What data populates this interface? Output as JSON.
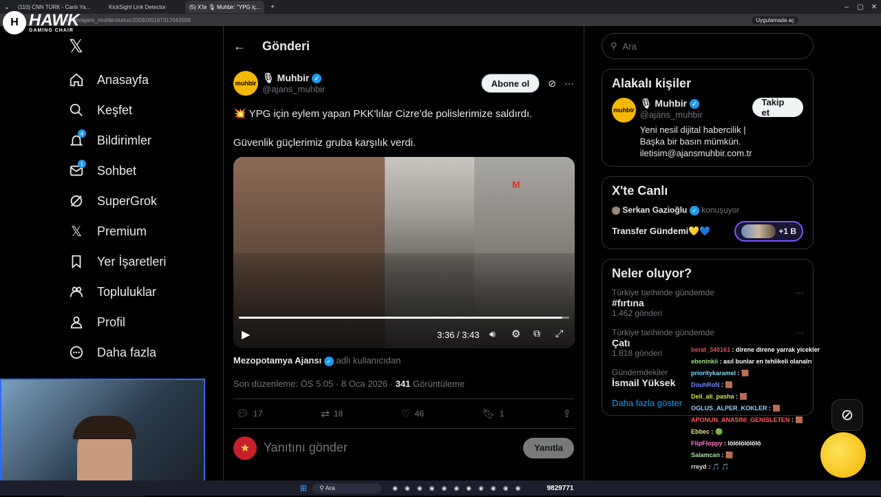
{
  "browser": {
    "tabs": [
      "(110) CNN TÜRK - Canlı Ya...",
      "KickSight Link Detector",
      "(5) X'te 🎙 Muhbir: \"YPG iç..."
    ],
    "url": "x.com/ajans_muhbir/status/2009265167317043508",
    "app_button": "Uygulamada aç"
  },
  "overlay": {
    "brand": "HAWK",
    "brand_sub": "GAMING CHAIR"
  },
  "nav": {
    "items": [
      {
        "label": "Anasayfa",
        "icon": "home-icon"
      },
      {
        "label": "Keşfet",
        "icon": "search-icon"
      },
      {
        "label": "Bildirimler",
        "icon": "bell-icon",
        "badge": "4"
      },
      {
        "label": "Sohbet",
        "icon": "mail-icon",
        "badge": "1"
      },
      {
        "label": "SuperGrok",
        "icon": "grok-icon"
      },
      {
        "label": "Premium",
        "icon": "x-icon"
      },
      {
        "label": "Yer İşaretleri",
        "icon": "bookmark-icon"
      },
      {
        "label": "Topluluklar",
        "icon": "people-icon"
      },
      {
        "label": "Profil",
        "icon": "person-icon"
      },
      {
        "label": "Daha fazla",
        "icon": "more-icon"
      }
    ]
  },
  "post": {
    "header": "Gönderi",
    "author_name": "🎙 Muhbir",
    "author_handle": "@ajans_muhbir",
    "subscribe": "Abone ol",
    "text1": "💥 YPG için eylem yapan PKK'lılar Cizre'de polislerimize saldırdı.",
    "text2": "Güvenlik güçlerimiz gruba karşılık verdi.",
    "video_time": "3:36 / 3:43",
    "video_progress": 0.98,
    "source_name": "Mezopotamya Ajansı",
    "source_suffix": "adlı kullanıcıdan",
    "edited": "Son düzenleme: ÖS 5:05 · 8 Oca 2026 ·",
    "views": "341",
    "views_label": "Görüntüleme",
    "replies": "17",
    "reposts": "18",
    "likes": "46",
    "bookmarks": "1",
    "reply_placeholder": "Yanıtını gönder",
    "reply_button": "Yanıtla"
  },
  "sidebar": {
    "search_placeholder": "Ara",
    "related_title": "Alakalı kişiler",
    "related_name": "🎙 Muhbir",
    "related_handle": "@ajans_muhbir",
    "follow": "Takip et",
    "related_bio": "Yeni nesil dijital habercilik | Başka bir basın mümkün. iletisim@ajansmuhbir.com.tr",
    "live_title": "X'te Canlı",
    "live_host": "Serkan Gazioğlu",
    "live_status": "konuşuyor",
    "live_topic": "Transfer Gündemi💛💙",
    "live_count": "+1 B",
    "trends_title": "Neler oluyor?",
    "trends": [
      {
        "context": "Türkiye tarihinde gündemde",
        "name": "#fırtına",
        "count": "1.462 gönderi"
      },
      {
        "context": "Türkiye tarihinde gündemde",
        "name": "Çatı",
        "count": "1.818 gönderi"
      },
      {
        "context": "Gündemdekiler",
        "name": "İsmail Yüksek",
        "count": ""
      }
    ],
    "show_more": "Daha fazla göster"
  },
  "chat": [
    {
      "user": "berat_340161",
      "msg": "direne direne yarrak yicekler",
      "color": "#e05050"
    },
    {
      "user": "ebeninkii",
      "msg": "asıl bunlar en tehlikeli olanalrı",
      "color": "#9be07a"
    },
    {
      "user": "prioritykaramel",
      "msg": "🟫",
      "color": "#7ad7ff"
    },
    {
      "user": "DouhRoN",
      "msg": "🟫",
      "color": "#6a8cff"
    },
    {
      "user": "Deli_ali_pasha",
      "msg": "🟫",
      "color": "#d6e84a"
    },
    {
      "user": "OGLUS_ALPER_KOKLER",
      "msg": "🟫",
      "color": "#9ad0ff"
    },
    {
      "user": "APONUN_ANASINI_GENISLETEN",
      "msg": "🟫",
      "color": "#ff5a5a"
    },
    {
      "user": "Ebbec",
      "msg": "🟢",
      "color": "#e7e27a"
    },
    {
      "user": "FlipFloppy",
      "msg": "lölölölölölö",
      "color": "#ff7ad0"
    },
    {
      "user": "Salamcan",
      "msg": "🟫",
      "color": "#a0e0a0"
    },
    {
      "user": "rreyd",
      "msg": "🎵 🎵",
      "color": "#e0e0e0"
    }
  ],
  "taskbar": {
    "search": "Ara",
    "viewer_count": "9829771"
  }
}
